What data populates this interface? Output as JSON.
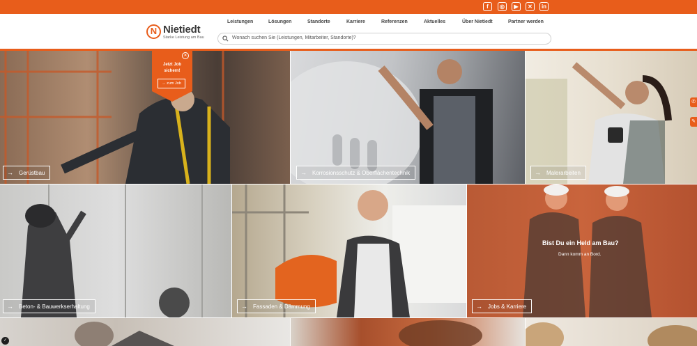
{
  "brand": {
    "name": "Nietiedt",
    "tagline": "Starke Leistung am Bau",
    "accent_color": "#e85d1b"
  },
  "social": [
    {
      "icon": "facebook-icon",
      "glyph": "f"
    },
    {
      "icon": "instagram-icon",
      "glyph": "◎"
    },
    {
      "icon": "youtube-icon",
      "glyph": "▶"
    },
    {
      "icon": "xing-icon",
      "glyph": "✕"
    },
    {
      "icon": "linkedin-icon",
      "glyph": "in"
    }
  ],
  "nav": [
    "Leistungen",
    "Lösungen",
    "Standorte",
    "Karriere",
    "Referenzen",
    "Aktuelles",
    "Über Nietiedt",
    "Partner werden"
  ],
  "search": {
    "placeholder": "Wonach suchen Sie (Leistungen, Mitarbeiter, Standorte)?"
  },
  "job_badge": {
    "title": "Jetzt Job sichern!",
    "link": "zum Job"
  },
  "tiles": [
    {
      "label": "Gerüstbau"
    },
    {
      "label": "Korrosionsschutz & Oberflächentechnik"
    },
    {
      "label": "Malerarbeiten"
    },
    {
      "label": "Beton- & Bauwerkserhaltung"
    },
    {
      "label": "Fassaden & Dämmung"
    },
    {
      "label": "Jobs & Karriere"
    }
  ],
  "hero": {
    "headline": "Bist Du ein Held am Bau?",
    "subline": "Dann komm an Bord."
  },
  "side_tabs": [
    {
      "icon": "phone-icon",
      "glyph": "✆"
    },
    {
      "icon": "edit-icon",
      "glyph": "✎"
    }
  ]
}
